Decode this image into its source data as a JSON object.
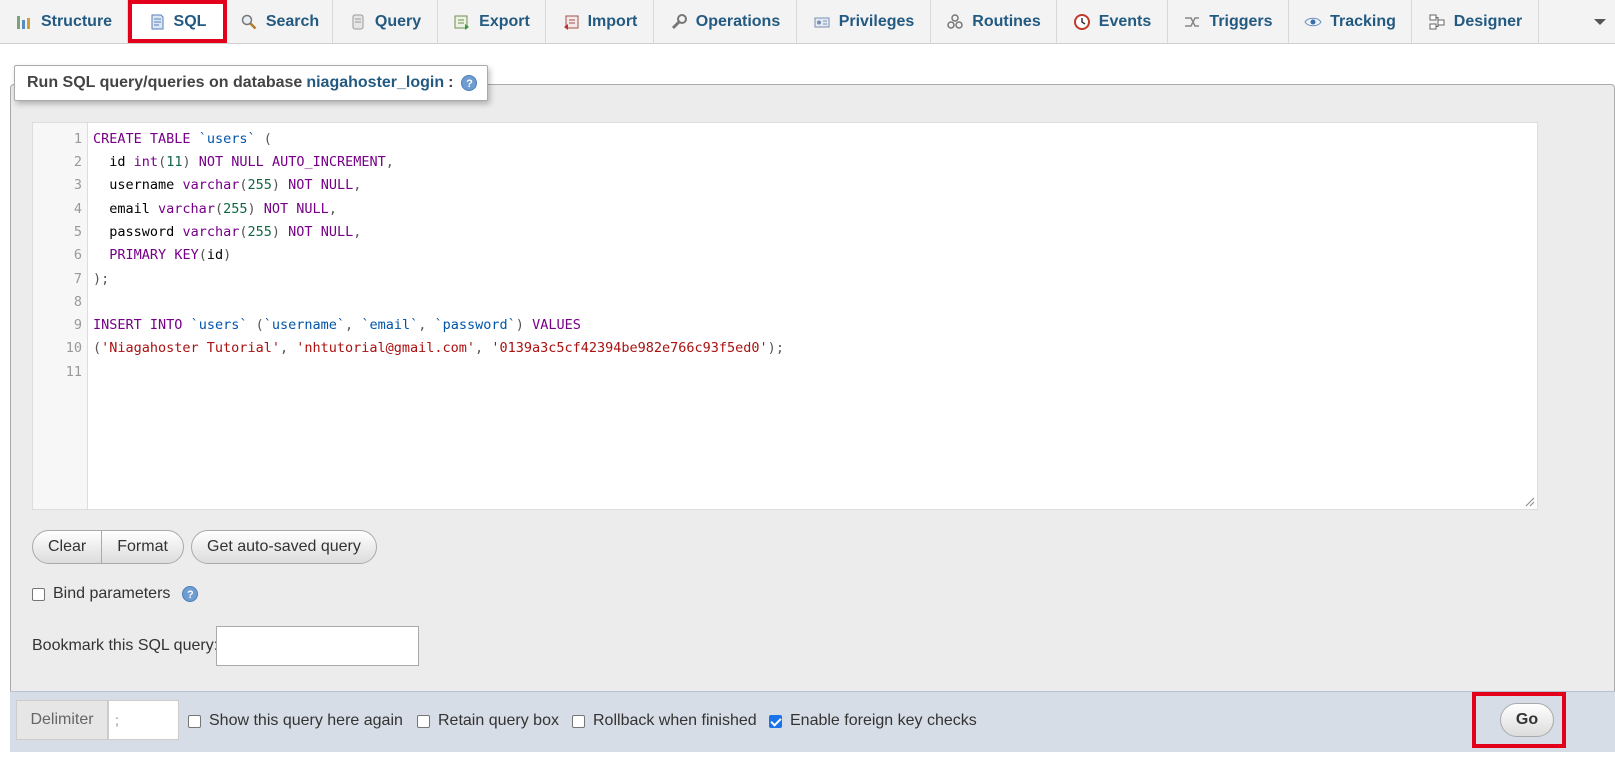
{
  "tabs": [
    {
      "label": "Structure",
      "icon": "structure-icon",
      "active": false
    },
    {
      "label": "SQL",
      "icon": "sql-icon",
      "active": true
    },
    {
      "label": "Search",
      "icon": "search-icon",
      "active": false
    },
    {
      "label": "Query",
      "icon": "query-icon",
      "active": false
    },
    {
      "label": "Export",
      "icon": "export-icon",
      "active": false
    },
    {
      "label": "Import",
      "icon": "import-icon",
      "active": false
    },
    {
      "label": "Operations",
      "icon": "operations-icon",
      "active": false
    },
    {
      "label": "Privileges",
      "icon": "privileges-icon",
      "active": false
    },
    {
      "label": "Routines",
      "icon": "routines-icon",
      "active": false
    },
    {
      "label": "Events",
      "icon": "events-icon",
      "active": false
    },
    {
      "label": "Triggers",
      "icon": "triggers-icon",
      "active": false
    },
    {
      "label": "Tracking",
      "icon": "tracking-icon",
      "active": false
    },
    {
      "label": "Designer",
      "icon": "designer-icon",
      "active": false
    }
  ],
  "panel": {
    "legend_prefix": "Run SQL query/queries on database",
    "database": "niagahoster_login",
    "legend_suffix": ":"
  },
  "editor": {
    "line_numbers": [
      "1",
      "2",
      "3",
      "4",
      "5",
      "6",
      "7",
      "8",
      "9",
      "10",
      "11"
    ],
    "lines": [
      "CREATE TABLE `users` (",
      "  id int(11) NOT NULL AUTO_INCREMENT,",
      "  username varchar(255) NOT NULL,",
      "  email varchar(255) NOT NULL,",
      "  password varchar(255) NOT NULL,",
      "  PRIMARY KEY(id)",
      ");",
      "",
      "INSERT INTO `users` (`username`, `email`, `password`) VALUES",
      "('Niagahoster Tutorial', 'nhtutorial@gmail.com', '0139a3c5cf42394be982e766c93f5ed0');",
      ""
    ]
  },
  "buttons": {
    "clear": "Clear",
    "format": "Format",
    "autosaved": "Get auto-saved query"
  },
  "bind_parameters": {
    "label": "Bind parameters",
    "checked": false
  },
  "bookmark": {
    "label": "Bookmark this SQL query:",
    "value": ""
  },
  "bottom": {
    "delimiter_label": "Delimiter",
    "delimiter_value": ";",
    "options": [
      {
        "label": "Show this query here again",
        "checked": false
      },
      {
        "label": "Retain query box",
        "checked": false
      },
      {
        "label": "Rollback when finished",
        "checked": false
      },
      {
        "label": "Enable foreign key checks",
        "checked": true
      }
    ],
    "go": "Go"
  },
  "colors": {
    "link": "#235a81",
    "highlight": "#e3001b",
    "keyword": "#770088",
    "string": "#aa1111",
    "number": "#116644",
    "backtick": "#0055aa"
  }
}
